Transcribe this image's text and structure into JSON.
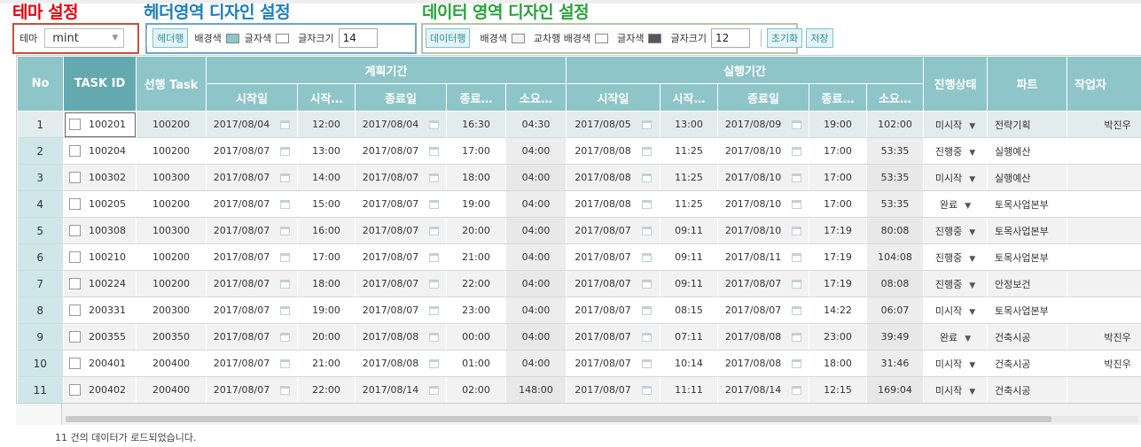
{
  "annotations": {
    "theme": "테마 설정",
    "header_design": "헤더영역 디자인 설정",
    "data_design": "데이터 영역 디자인 설정"
  },
  "toolbar": {
    "theme_label": "테마",
    "theme_value": "mint",
    "header_row_button": "헤더행",
    "bg_color_label": "배경색",
    "font_color_label": "글자색",
    "font_size_label": "글자크기",
    "header_font_size": "14",
    "data_row_button": "데이터행",
    "alt_bg_color_label": "교차행 배경색",
    "data_font_size": "12",
    "reset_button": "초기화",
    "save_button": "저장",
    "header_bg_color": "#8ec5c8",
    "header_font_color": "#ffffff",
    "data_bg_color": "#f2f2f2",
    "alt_bg_color": "#ffffff",
    "data_font_color": "#555560"
  },
  "grid": {
    "headers": {
      "no": "No",
      "task_id": "TASK ID",
      "pred_task": "선행 Task",
      "plan_group": "계획기간",
      "actual_group": "실행기간",
      "start_date": "시작일",
      "start_time": "시작…",
      "end_date": "종료일",
      "end_time": "종료…",
      "duration": "소요…",
      "status": "진행상태",
      "part": "파트",
      "worker": "작업자"
    },
    "rows": [
      {
        "no": "1",
        "task_id": "100201",
        "pred": "100200",
        "p_sd": "2017/08/04",
        "p_st": "12:00",
        "p_ed": "2017/08/04",
        "p_et": "16:30",
        "p_dur": "04:30",
        "a_sd": "2017/08/05",
        "a_st": "13:00",
        "a_ed": "2017/08/09",
        "a_et": "19:00",
        "a_dur": "102:00",
        "status": "미시작",
        "part": "전략기획",
        "worker": "박진우"
      },
      {
        "no": "2",
        "task_id": "100204",
        "pred": "100200",
        "p_sd": "2017/08/07",
        "p_st": "13:00",
        "p_ed": "2017/08/07",
        "p_et": "17:00",
        "p_dur": "04:00",
        "a_sd": "2017/08/08",
        "a_st": "11:25",
        "a_ed": "2017/08/10",
        "a_et": "17:00",
        "a_dur": "53:35",
        "status": "진행중",
        "part": "실행예산",
        "worker": ""
      },
      {
        "no": "3",
        "task_id": "100302",
        "pred": "100300",
        "p_sd": "2017/08/07",
        "p_st": "14:00",
        "p_ed": "2017/08/07",
        "p_et": "18:00",
        "p_dur": "04:00",
        "a_sd": "2017/08/08",
        "a_st": "11:25",
        "a_ed": "2017/08/10",
        "a_et": "17:00",
        "a_dur": "53:35",
        "status": "미시작",
        "part": "실행예산",
        "worker": ""
      },
      {
        "no": "4",
        "task_id": "100205",
        "pred": "100200",
        "p_sd": "2017/08/07",
        "p_st": "15:00",
        "p_ed": "2017/08/07",
        "p_et": "19:00",
        "p_dur": "04:00",
        "a_sd": "2017/08/08",
        "a_st": "11:25",
        "a_ed": "2017/08/10",
        "a_et": "17:00",
        "a_dur": "53:35",
        "status": "완료",
        "part": "토목사업본부",
        "worker": ""
      },
      {
        "no": "5",
        "task_id": "100308",
        "pred": "100300",
        "p_sd": "2017/08/07",
        "p_st": "16:00",
        "p_ed": "2017/08/07",
        "p_et": "20:00",
        "p_dur": "04:00",
        "a_sd": "2017/08/07",
        "a_st": "09:11",
        "a_ed": "2017/08/10",
        "a_et": "17:19",
        "a_dur": "80:08",
        "status": "진행중",
        "part": "토목사업본부",
        "worker": ""
      },
      {
        "no": "6",
        "task_id": "100210",
        "pred": "100200",
        "p_sd": "2017/08/07",
        "p_st": "17:00",
        "p_ed": "2017/08/07",
        "p_et": "21:00",
        "p_dur": "04:00",
        "a_sd": "2017/08/07",
        "a_st": "09:11",
        "a_ed": "2017/08/11",
        "a_et": "17:19",
        "a_dur": "104:08",
        "status": "진행중",
        "part": "토목사업본부",
        "worker": ""
      },
      {
        "no": "7",
        "task_id": "100224",
        "pred": "100200",
        "p_sd": "2017/08/07",
        "p_st": "18:00",
        "p_ed": "2017/08/07",
        "p_et": "22:00",
        "p_dur": "04:00",
        "a_sd": "2017/08/07",
        "a_st": "09:11",
        "a_ed": "2017/08/07",
        "a_et": "17:19",
        "a_dur": "08:08",
        "status": "진행중",
        "part": "안정보건",
        "worker": ""
      },
      {
        "no": "8",
        "task_id": "200331",
        "pred": "200300",
        "p_sd": "2017/08/07",
        "p_st": "19:00",
        "p_ed": "2017/08/07",
        "p_et": "23:00",
        "p_dur": "04:00",
        "a_sd": "2017/08/07",
        "a_st": "08:15",
        "a_ed": "2017/08/07",
        "a_et": "14:22",
        "a_dur": "06:07",
        "status": "미시작",
        "part": "토목사업본부",
        "worker": ""
      },
      {
        "no": "9",
        "task_id": "200355",
        "pred": "200350",
        "p_sd": "2017/08/07",
        "p_st": "20:00",
        "p_ed": "2017/08/08",
        "p_et": "00:00",
        "p_dur": "04:00",
        "a_sd": "2017/08/07",
        "a_st": "07:11",
        "a_ed": "2017/08/08",
        "a_et": "23:00",
        "a_dur": "39:49",
        "status": "완료",
        "part": "건축시공",
        "worker": "박진우"
      },
      {
        "no": "10",
        "task_id": "200401",
        "pred": "200400",
        "p_sd": "2017/08/07",
        "p_st": "21:00",
        "p_ed": "2017/08/08",
        "p_et": "01:00",
        "p_dur": "04:00",
        "a_sd": "2017/08/07",
        "a_st": "10:14",
        "a_ed": "2017/08/08",
        "a_et": "18:00",
        "a_dur": "31:46",
        "status": "미시작",
        "part": "건축시공",
        "worker": "박진우"
      },
      {
        "no": "11",
        "task_id": "200402",
        "pred": "200400",
        "p_sd": "2017/08/07",
        "p_st": "22:00",
        "p_ed": "2017/08/14",
        "p_et": "02:00",
        "p_dur": "148:00",
        "a_sd": "2017/08/07",
        "a_st": "11:11",
        "a_ed": "2017/08/14",
        "a_et": "12:15",
        "a_dur": "169:04",
        "status": "미시작",
        "part": "건축시공",
        "worker": ""
      }
    ]
  },
  "status_text": "11 건의 데이터가 로드되었습니다."
}
